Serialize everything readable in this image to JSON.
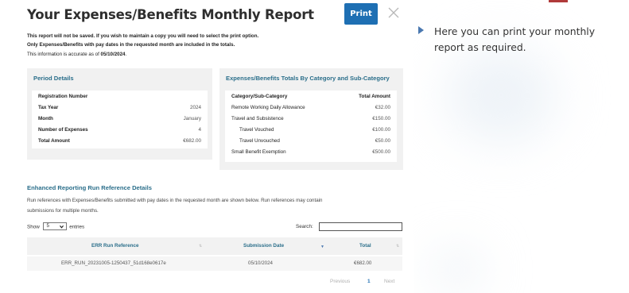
{
  "report": {
    "title": "Your Expenses/Benefits Monthly Report",
    "print_label": "Print",
    "notes": [
      "This report will not be saved.  If you wish to maintain a copy you will need to select the print option.",
      "Only Expenses/Benefits with pay dates in the requested month are included in the totals."
    ],
    "accuracy_prefix": "This information is accurate as of ",
    "accuracy_date": "05/10/2024",
    "accuracy_suffix": "."
  },
  "period": {
    "title": "Period Details",
    "rows": [
      {
        "label": "Registration Number",
        "value": ""
      },
      {
        "label": "Tax Year",
        "value": "2024"
      },
      {
        "label": "Month",
        "value": "January"
      },
      {
        "label": "Number of Expenses",
        "value": "4"
      },
      {
        "label": "Total Amount",
        "value": "€682.00"
      }
    ]
  },
  "totals": {
    "title": "Expenses/Benefits Totals By Category and Sub-Category",
    "header": {
      "label": "Category/Sub-Category",
      "value": "Total Amount"
    },
    "rows": [
      {
        "label": "Remote Working Daily Allowance",
        "value": "€32.00"
      },
      {
        "label": "Travel and Subsistence",
        "value": "€150.00"
      },
      {
        "label": "Travel Vouched",
        "value": "€100.00"
      },
      {
        "label": "Travel Unvouched",
        "value": "€50.00"
      },
      {
        "label": "Small Benefit Exemption",
        "value": "€500.00"
      }
    ]
  },
  "err": {
    "title": "Enhanced Reporting Run Reference Details",
    "desc_line1": "Run references with Expenses/Benefits submitted with pay dates in the requested month are shown below. Run references may contain",
    "desc_line2": "submissions for multiple months.",
    "show_prefix": "Show",
    "show_value": "5",
    "show_suffix": "entries",
    "search_label": "Search:",
    "columns": [
      "ERR Run Reference",
      "Submission Date",
      "Total"
    ],
    "rows": [
      {
        "ref": "ERR_RUN_20231005-1250437_51d168e0617e",
        "date": "05/10/2024",
        "total": "€682.00"
      }
    ],
    "pager": {
      "previous": "Previous",
      "page": "1",
      "next": "Next"
    }
  },
  "side_note": "Here you can print your monthly report as required.",
  "colors": {
    "accent": "#1e6fb3",
    "heading": "#2a6e8a",
    "panel": "#f1f1f1",
    "arrow": "#4a78b0"
  }
}
